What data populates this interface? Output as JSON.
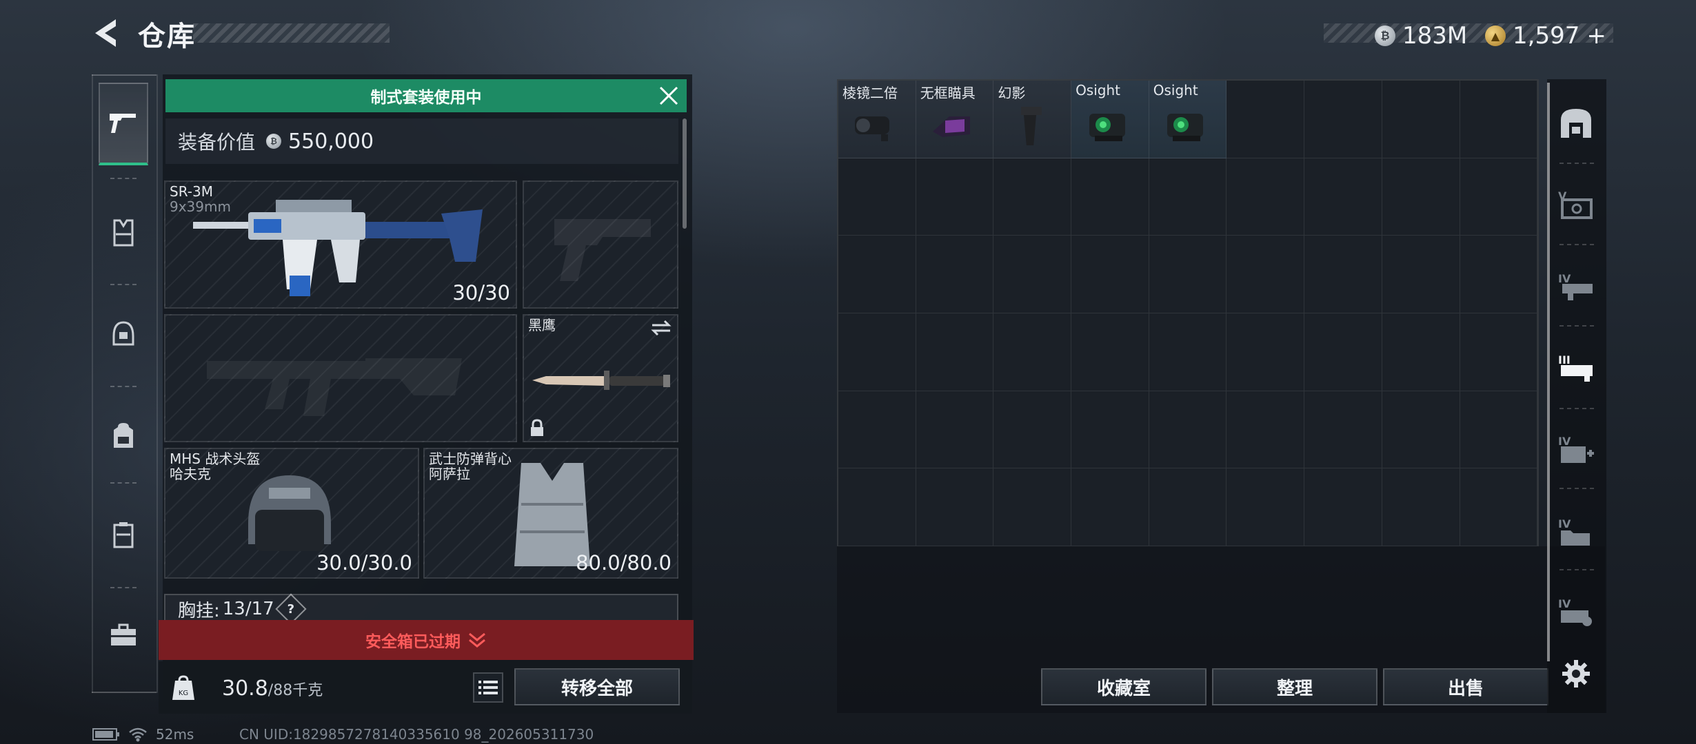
{
  "header": {
    "title": "仓库",
    "currencies": [
      {
        "icon": "silver-coin-icon",
        "value": "183M"
      },
      {
        "icon": "gold-coin-icon",
        "value": "1,597"
      }
    ],
    "add_currency": "+"
  },
  "categories": [
    {
      "name": "weapon",
      "icon": "pistol-icon",
      "active": true
    },
    {
      "name": "armor",
      "icon": "vest-icon",
      "active": false
    },
    {
      "name": "helmet",
      "icon": "helmet-icon",
      "active": false
    },
    {
      "name": "backpack",
      "icon": "backpack-icon",
      "active": false
    },
    {
      "name": "container",
      "icon": "case-icon",
      "active": false
    },
    {
      "name": "toolbox",
      "icon": "toolbox-icon",
      "active": false
    }
  ],
  "loadout": {
    "banner": "制式套装使用中",
    "value_label": "装备价值",
    "value": "550,000",
    "primary": {
      "name": "SR-3M",
      "caliber": "9x39mm",
      "ammo": "30/30"
    },
    "melee": {
      "name": "黑鹰"
    },
    "helmet": {
      "name": "MHS 战术头盔",
      "sub": "哈夫克",
      "durability": "30.0/30.0"
    },
    "vest": {
      "name": "武士防弹背心",
      "sub": "阿萨拉",
      "durability": "80.0/80.0"
    },
    "chest_rig": {
      "label": "胸挂:",
      "value": "13/17",
      "help": "?"
    },
    "safebox_warning": "安全箱已过期",
    "weight": {
      "current": "30.8",
      "max": "/88千克"
    },
    "transfer_all": "转移全部"
  },
  "storage": {
    "items": [
      {
        "label": "棱镜二倍",
        "icon": "scope-2x-icon"
      },
      {
        "label": "无框瞄具",
        "icon": "frameless-sight-icon"
      },
      {
        "label": "幻影",
        "icon": "grip-icon"
      },
      {
        "label": "Osight",
        "icon": "osight-icon"
      },
      {
        "label": "Osight",
        "icon": "osight-icon"
      }
    ],
    "columns": 9,
    "rows": 6,
    "buttons": {
      "collection": "收藏室",
      "organize": "整理",
      "sell": "出售"
    }
  },
  "status_bar": {
    "ping": "52ms",
    "uid": "CN UID:1829857278140335610 98_202605311730"
  },
  "colors": {
    "banner": "#1d8b64",
    "warning_bg": "#7a1d22",
    "warning_text": "#ff5b5b",
    "active_accent": "#2fbf8a"
  }
}
